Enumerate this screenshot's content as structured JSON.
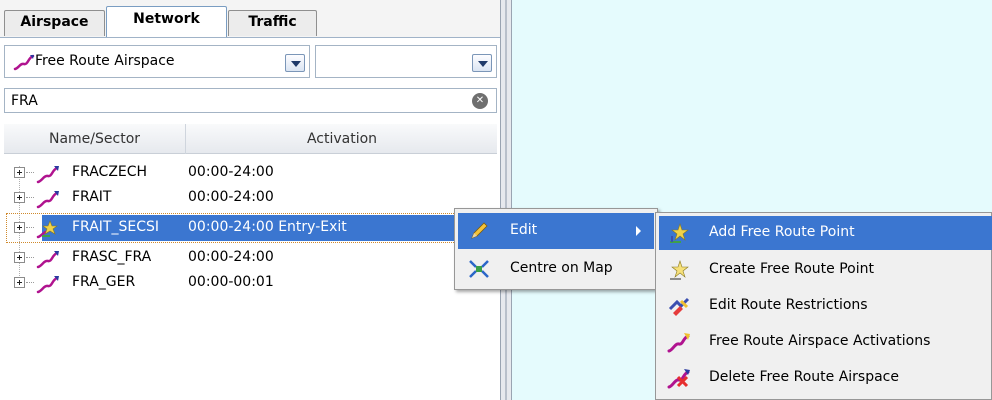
{
  "tabs": [
    {
      "label": "Airspace"
    },
    {
      "label": "Network",
      "active": true
    },
    {
      "label": "Traffic"
    }
  ],
  "filter": {
    "airspace_type": {
      "selected": "Free Route Airspace",
      "icon": "free-route-airspace-icon"
    },
    "secondary": {
      "selected": ""
    }
  },
  "search": {
    "value": "FRA"
  },
  "grid": {
    "columns": [
      "Name/Sector",
      "Activation"
    ],
    "rows": [
      {
        "name": "FRACZECH",
        "activation": "00:00-24:00",
        "icon": "free-route-airspace-icon"
      },
      {
        "name": "FRAIT",
        "activation": "00:00-24:00",
        "icon": "free-route-airspace-icon"
      },
      {
        "name": "FRAIT_SECSI",
        "activation": "00:00-24:00 Entry-Exit",
        "icon": "free-route-point-icon",
        "selected": true
      },
      {
        "name": "FRASC_FRA",
        "activation": "00:00-24:00",
        "icon": "free-route-airspace-icon"
      },
      {
        "name": "FRA_GER",
        "activation": "00:00-00:01",
        "icon": "free-route-airspace-icon"
      }
    ]
  },
  "context_menu": {
    "items": [
      {
        "label": "Edit",
        "icon": "pencil-icon",
        "has_submenu": true
      },
      {
        "label": "Centre on Map",
        "icon": "centre-map-icon"
      }
    ]
  },
  "edit_submenu": {
    "items": [
      {
        "label": "Add Free Route Point",
        "icon": "add-point-icon"
      },
      {
        "label": "Create Free Route Point",
        "icon": "create-point-icon"
      },
      {
        "label": "Edit Route Restrictions",
        "icon": "route-restrictions-icon"
      },
      {
        "label": "Free Route Airspace Activations",
        "icon": "free-route-airspace-icon"
      },
      {
        "label": "Delete Free Route Airspace",
        "icon": "delete-airspace-icon"
      }
    ]
  },
  "colors": {
    "selection": "#3b76d0",
    "map_background": "#e5fbfd",
    "menu_background": "#f0f0f0"
  }
}
